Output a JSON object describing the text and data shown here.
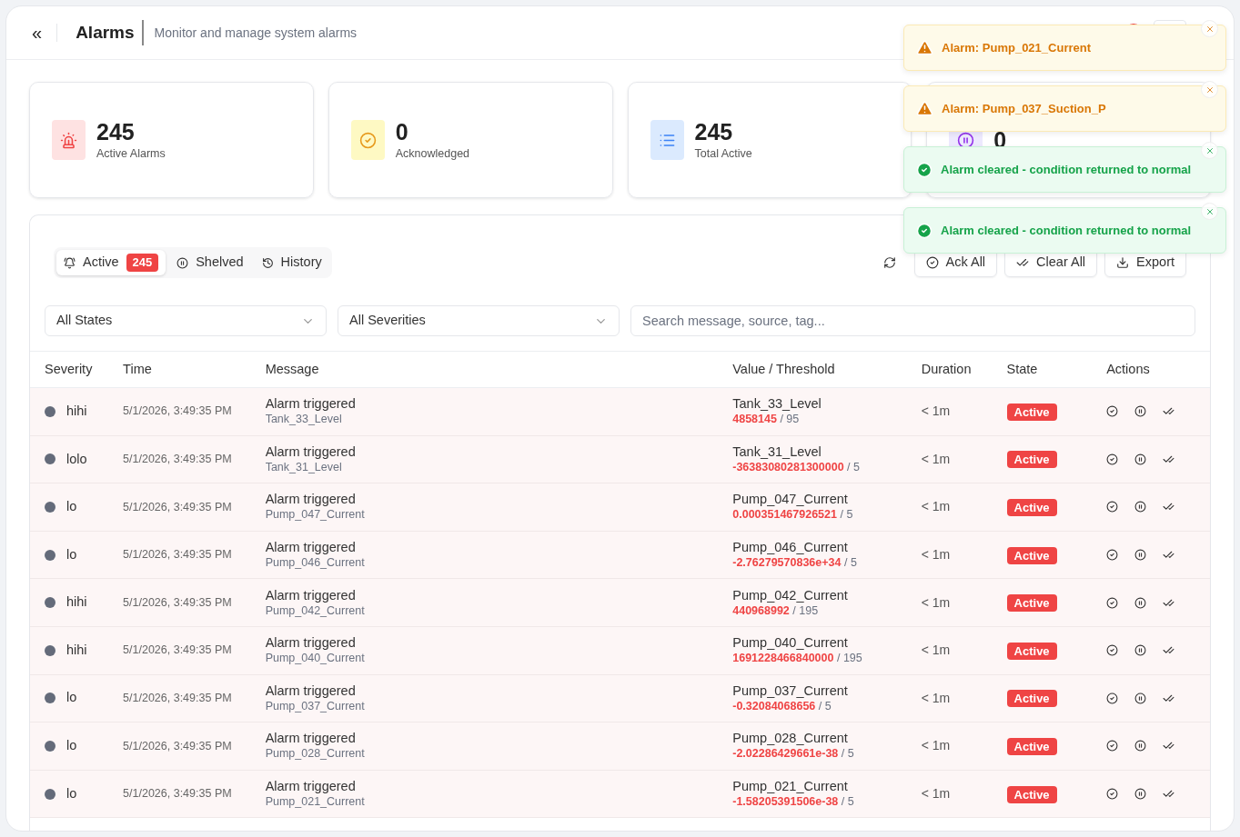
{
  "header": {
    "back_icon": "«",
    "title": "Alarms",
    "subtitle": "Monitor and manage system alarms"
  },
  "stats": [
    {
      "kind": "active",
      "value": "245",
      "label": "Active Alarms"
    },
    {
      "kind": "ack",
      "value": "0",
      "label": "Acknowledged"
    },
    {
      "kind": "total",
      "value": "245",
      "label": "Total Active"
    },
    {
      "kind": "shelved",
      "value": "0"
    }
  ],
  "tabs": [
    {
      "kind": "active",
      "label": "Active",
      "count": "245",
      "selected": true
    },
    {
      "kind": "shelved",
      "label": "Shelved",
      "selected": false
    },
    {
      "kind": "history",
      "label": "History",
      "selected": false
    }
  ],
  "actions": [
    {
      "kind": "ack",
      "label": "Ack All"
    },
    {
      "kind": "clear",
      "label": "Clear All"
    },
    {
      "kind": "export",
      "label": "Export"
    }
  ],
  "filters": {
    "state": "All States",
    "severity": "All Severities",
    "search_placeholder": "Search message, source, tag..."
  },
  "table": {
    "columns": [
      "Severity",
      "Time",
      "Message",
      "Value / Threshold",
      "Duration",
      "State",
      "Actions"
    ],
    "rows": [
      {
        "severity": "hihi",
        "time": "5/1/2026, 3:49:35 PM",
        "message": "Alarm triggered",
        "source": "Tank_33_Level",
        "tag": "Tank_33_Level",
        "reading": "**4858145** / 95",
        "duration": "< 1m",
        "state": "Active"
      },
      {
        "severity": "lolo",
        "time": "5/1/2026, 3:49:35 PM",
        "message": "Alarm triggered",
        "source": "Tank_31_Level",
        "tag": "Tank_31_Level",
        "reading": "**-36383080281300000** / 5",
        "duration": "< 1m",
        "state": "Active"
      },
      {
        "severity": "lo",
        "time": "5/1/2026, 3:49:35 PM",
        "message": "Alarm triggered",
        "source": "Pump_047_Current",
        "tag": "Pump_047_Current",
        "reading": "**0.000351467926521** / 5",
        "duration": "< 1m",
        "state": "Active"
      },
      {
        "severity": "lo",
        "time": "5/1/2026, 3:49:35 PM",
        "message": "Alarm triggered",
        "source": "Pump_046_Current",
        "tag": "Pump_046_Current",
        "reading": "**-2.76279570836e+34** / 5",
        "duration": "< 1m",
        "state": "Active"
      },
      {
        "severity": "hihi",
        "time": "5/1/2026, 3:49:35 PM",
        "message": "Alarm triggered",
        "source": "Pump_042_Current",
        "tag": "Pump_042_Current",
        "reading": "**440968992** / 195",
        "duration": "< 1m",
        "state": "Active"
      },
      {
        "severity": "hihi",
        "time": "5/1/2026, 3:49:35 PM",
        "message": "Alarm triggered",
        "source": "Pump_040_Current",
        "tag": "Pump_040_Current",
        "reading": "**1691228466840000** / 195",
        "duration": "< 1m",
        "state": "Active"
      },
      {
        "severity": "lo",
        "time": "5/1/2026, 3:49:35 PM",
        "message": "Alarm triggered",
        "source": "Pump_037_Current",
        "tag": "Pump_037_Current",
        "reading": "**-0.32084068656** / 5",
        "duration": "< 1m",
        "state": "Active"
      },
      {
        "severity": "lo",
        "time": "5/1/2026, 3:49:35 PM",
        "message": "Alarm triggered",
        "source": "Pump_028_Current",
        "tag": "Pump_028_Current",
        "reading": "**-2.02286429661e-38** / 5",
        "duration": "< 1m",
        "state": "Active"
      },
      {
        "severity": "lo",
        "time": "5/1/2026, 3:49:35 PM",
        "message": "Alarm triggered",
        "source": "Pump_021_Current",
        "tag": "Pump_021_Current",
        "reading": "**-1.58205391506e-38** / 5",
        "duration": "< 1m",
        "state": "Active"
      }
    ]
  },
  "toasts": [
    {
      "kind": "warning",
      "text": "Alarm: Pump_021_Current"
    },
    {
      "kind": "warning",
      "text": "Alarm: Pump_037_Suction_P"
    },
    {
      "kind": "success",
      "text": "Alarm cleared - condition returned to normal"
    },
    {
      "kind": "success",
      "text": "Alarm cleared - condition returned to normal"
    }
  ]
}
